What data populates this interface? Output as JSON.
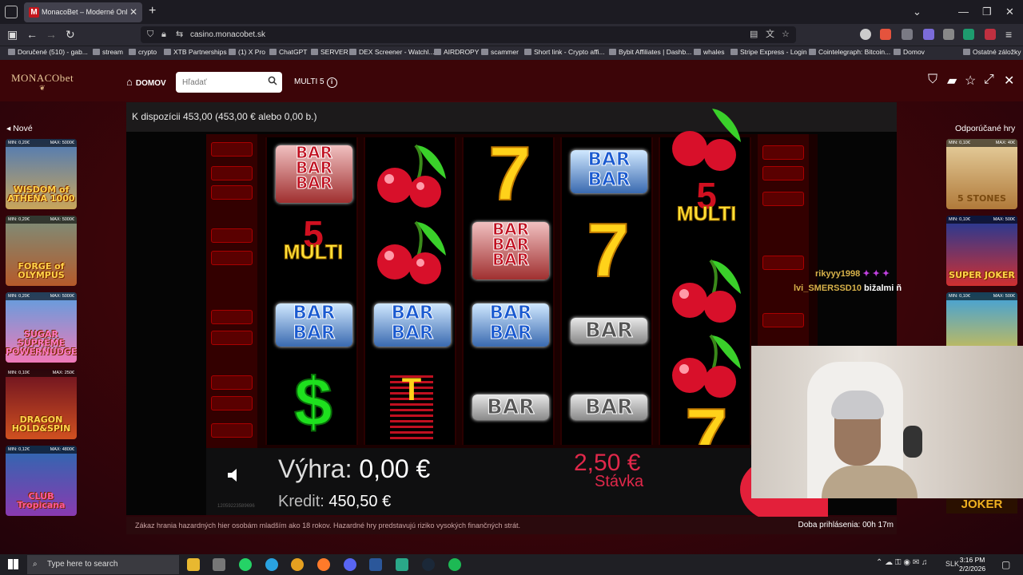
{
  "browser": {
    "tab_title": "MonacoBet – Moderné Onl",
    "tab_favicon": "M",
    "url": "casino.monacobet.sk",
    "bookmarks": [
      "Doručené (510) - gab...",
      "stream",
      "crypto",
      "XTB Partnerships",
      "(1) X Pro",
      "ChatGPT",
      "SERVER",
      "DEX Screener - Watchl...",
      "AIRDROPY",
      "scammer",
      "Short link - Crypto affi...",
      "Bybit Affiliates | Dashb...",
      "whales",
      "Stripe Express - Login",
      "Cointelegraph: Bitcoin...",
      "Domov"
    ],
    "other_bookmarks": "Ostatné záložky"
  },
  "site": {
    "logo": "MONACObet",
    "home": "DOMOV",
    "search_placeholder": "Hľadať",
    "game_name": "MULTI 5",
    "info": "i"
  },
  "left_panel": {
    "heading": "Nové",
    "games": [
      {
        "min": "MIN: 0,20€",
        "max": "MAX: 5000€",
        "title": "WISDOM of ATHENA 1000"
      },
      {
        "min": "MIN: 0,20€",
        "max": "MAX: 5000€",
        "title": "FORGE of OLYMPUS"
      },
      {
        "min": "MIN: 0,20€",
        "max": "MAX: 5000€",
        "title": "SUGAR SUPREME POWERNUDGE"
      },
      {
        "min": "MIN: 0,10€",
        "max": "MAX: 250€",
        "title": "DRAGON HOLD&SPIN"
      },
      {
        "min": "MIN: 0,12€",
        "max": "MAX: 4800€",
        "title": "CLUB Tropicana"
      }
    ]
  },
  "right_panel": {
    "heading": "Odporúčané hry",
    "games": [
      {
        "min": "MIN: 0,10€",
        "max": "MAX: 40€",
        "title": "5 STONES"
      },
      {
        "min": "MIN: 0,10€",
        "max": "MAX: 500€",
        "title": "SUPER JOKER"
      },
      {
        "min": "MIN: 0,10€",
        "max": "MAX: 500€",
        "title": ""
      }
    ],
    "bottom_label": "JOKER"
  },
  "game": {
    "balance_text": "K dispozícii 453,00 (453,00 € alebo 0,00 b.)",
    "win_label": "Výhra:",
    "win_value": "0,00 €",
    "credit_label": "Kredit:",
    "credit_value": "450,50 €",
    "bet_value": "2,50 €",
    "bet_label": "Stávka",
    "game_id": "12059223589696",
    "reel_symbols": {
      "bar3": [
        "BAR",
        "BAR",
        "BAR"
      ],
      "bar2": [
        "BAR",
        "BAR"
      ],
      "bar1": "BAR",
      "multi_number": "5",
      "multi_text": "MULTI",
      "seven": "7",
      "dollar": "$"
    }
  },
  "footer": {
    "disclaimer": "Zákaz hrania hazardných hier osobám mladším ako 18 rokov. Hazardné hry predstavujú riziko vysokých finančných strát.",
    "session": "Doba prihlásenia: 00h 17m"
  },
  "chat": {
    "line1_user": "rikyyy1998",
    "line2_user": "lvi_SMERSSD10",
    "line2_msg": "bižalmi ñ",
    "user1_color": "#d8b24a",
    "user2_color": "#d8b24a"
  },
  "taskbar": {
    "search_placeholder": "Type here to search",
    "time": "3:16 PM",
    "date": "2/2/2026",
    "lang": "SLK"
  },
  "colors": {
    "accent_red": "#e0284a",
    "header_bg": "#3c0508"
  }
}
